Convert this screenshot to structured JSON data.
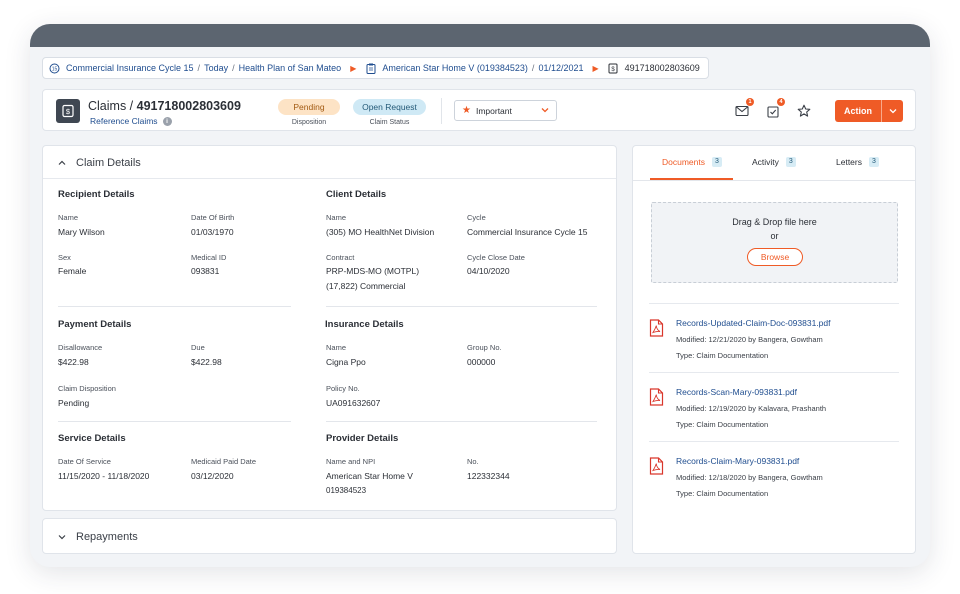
{
  "breadcrumb": {
    "items": [
      "Commercial Insurance Cycle 15",
      "Today",
      "Health Plan of San Mateo"
    ],
    "provider": "American Star Home V (019384523)",
    "provider_date": "01/12/2021",
    "claim_id": "491718002803609"
  },
  "header": {
    "title_prefix": "Claims / ",
    "claim_number": "491718002803609",
    "subtitle": "Reference Claims",
    "disposition_value": "Pending",
    "disposition_label": "Disposition",
    "status_value": "Open Request",
    "status_label": "Claim Status",
    "priority": "Important",
    "mail_badge": "1",
    "task_badge": "4",
    "action_label": "Action"
  },
  "claim_details": {
    "title": "Claim Details",
    "recipient": {
      "title": "Recipient Details",
      "name_label": "Name",
      "name": "Mary Wilson",
      "dob_label": "Date Of Birth",
      "dob": "01/03/1970",
      "sex_label": "Sex",
      "sex": "Female",
      "medical_id_label": "Medical ID",
      "medical_id": "093831"
    },
    "client": {
      "title": "Client Details",
      "name_label": "Name",
      "name": "(305) MO HealthNet Division",
      "cycle_label": "Cycle",
      "cycle": "Commercial Insurance Cycle 15",
      "contract_label": "Contract",
      "contract_line1": "PRP-MDS-MO (MOTPL)",
      "contract_line2": "(17,822) Commercial",
      "close_label": "Cycle Close Date",
      "close_date": "04/10/2020"
    },
    "payment": {
      "title": "Payment Details",
      "disallowance_label": "Disallowance",
      "disallowance": "$422.98",
      "due_label": "Due",
      "due": "$422.98",
      "disposition_label": "Claim Disposition",
      "disposition": "Pending"
    },
    "insurance": {
      "title": "Insurance Details",
      "name_label": "Name",
      "name": "Cigna Ppo",
      "group_label": "Group No.",
      "group": "000000",
      "policy_label": "Policy No.",
      "policy": "UA091632607"
    },
    "service": {
      "title": "Service Details",
      "dos_label": "Date Of Service",
      "dos": "11/15/2020 - 11/18/2020",
      "paid_label": "Medicaid Paid Date",
      "paid": "03/12/2020"
    },
    "provider": {
      "title": "Provider Details",
      "npi_label": "Name and NPI",
      "name_line1": "American Star Home V",
      "name_line2": "019384523",
      "no_label": "No.",
      "no": "122332344"
    }
  },
  "repayments": {
    "title": "Repayments"
  },
  "right_panel": {
    "tabs": [
      {
        "label": "Documents",
        "count": "3"
      },
      {
        "label": "Activity",
        "count": "3"
      },
      {
        "label": "Letters",
        "count": "3"
      }
    ],
    "drop_text": "Drag & Drop file here",
    "or_text": "or",
    "browse_label": "Browse",
    "documents": [
      {
        "name": "Records-Updated-Claim-Doc-093831.pdf",
        "modified": "Modified: 12/21/2020 by Bangera, Gowtham",
        "type": "Type: Claim Documentation"
      },
      {
        "name": "Records-Scan-Mary-093831.pdf",
        "modified": "Modified: 12/19/2020 by Kalavara, Prashanth",
        "type": "Type: Claim Documentation"
      },
      {
        "name": "Records-Claim-Mary-093831.pdf",
        "modified": "Modified: 12/18/2020 by Bangera, Gowtham",
        "type": "Type: Claim Documentation"
      }
    ]
  },
  "colors": {
    "accent": "#ef5b26",
    "link": "#1f4d8f",
    "topbar": "#5c6570"
  }
}
